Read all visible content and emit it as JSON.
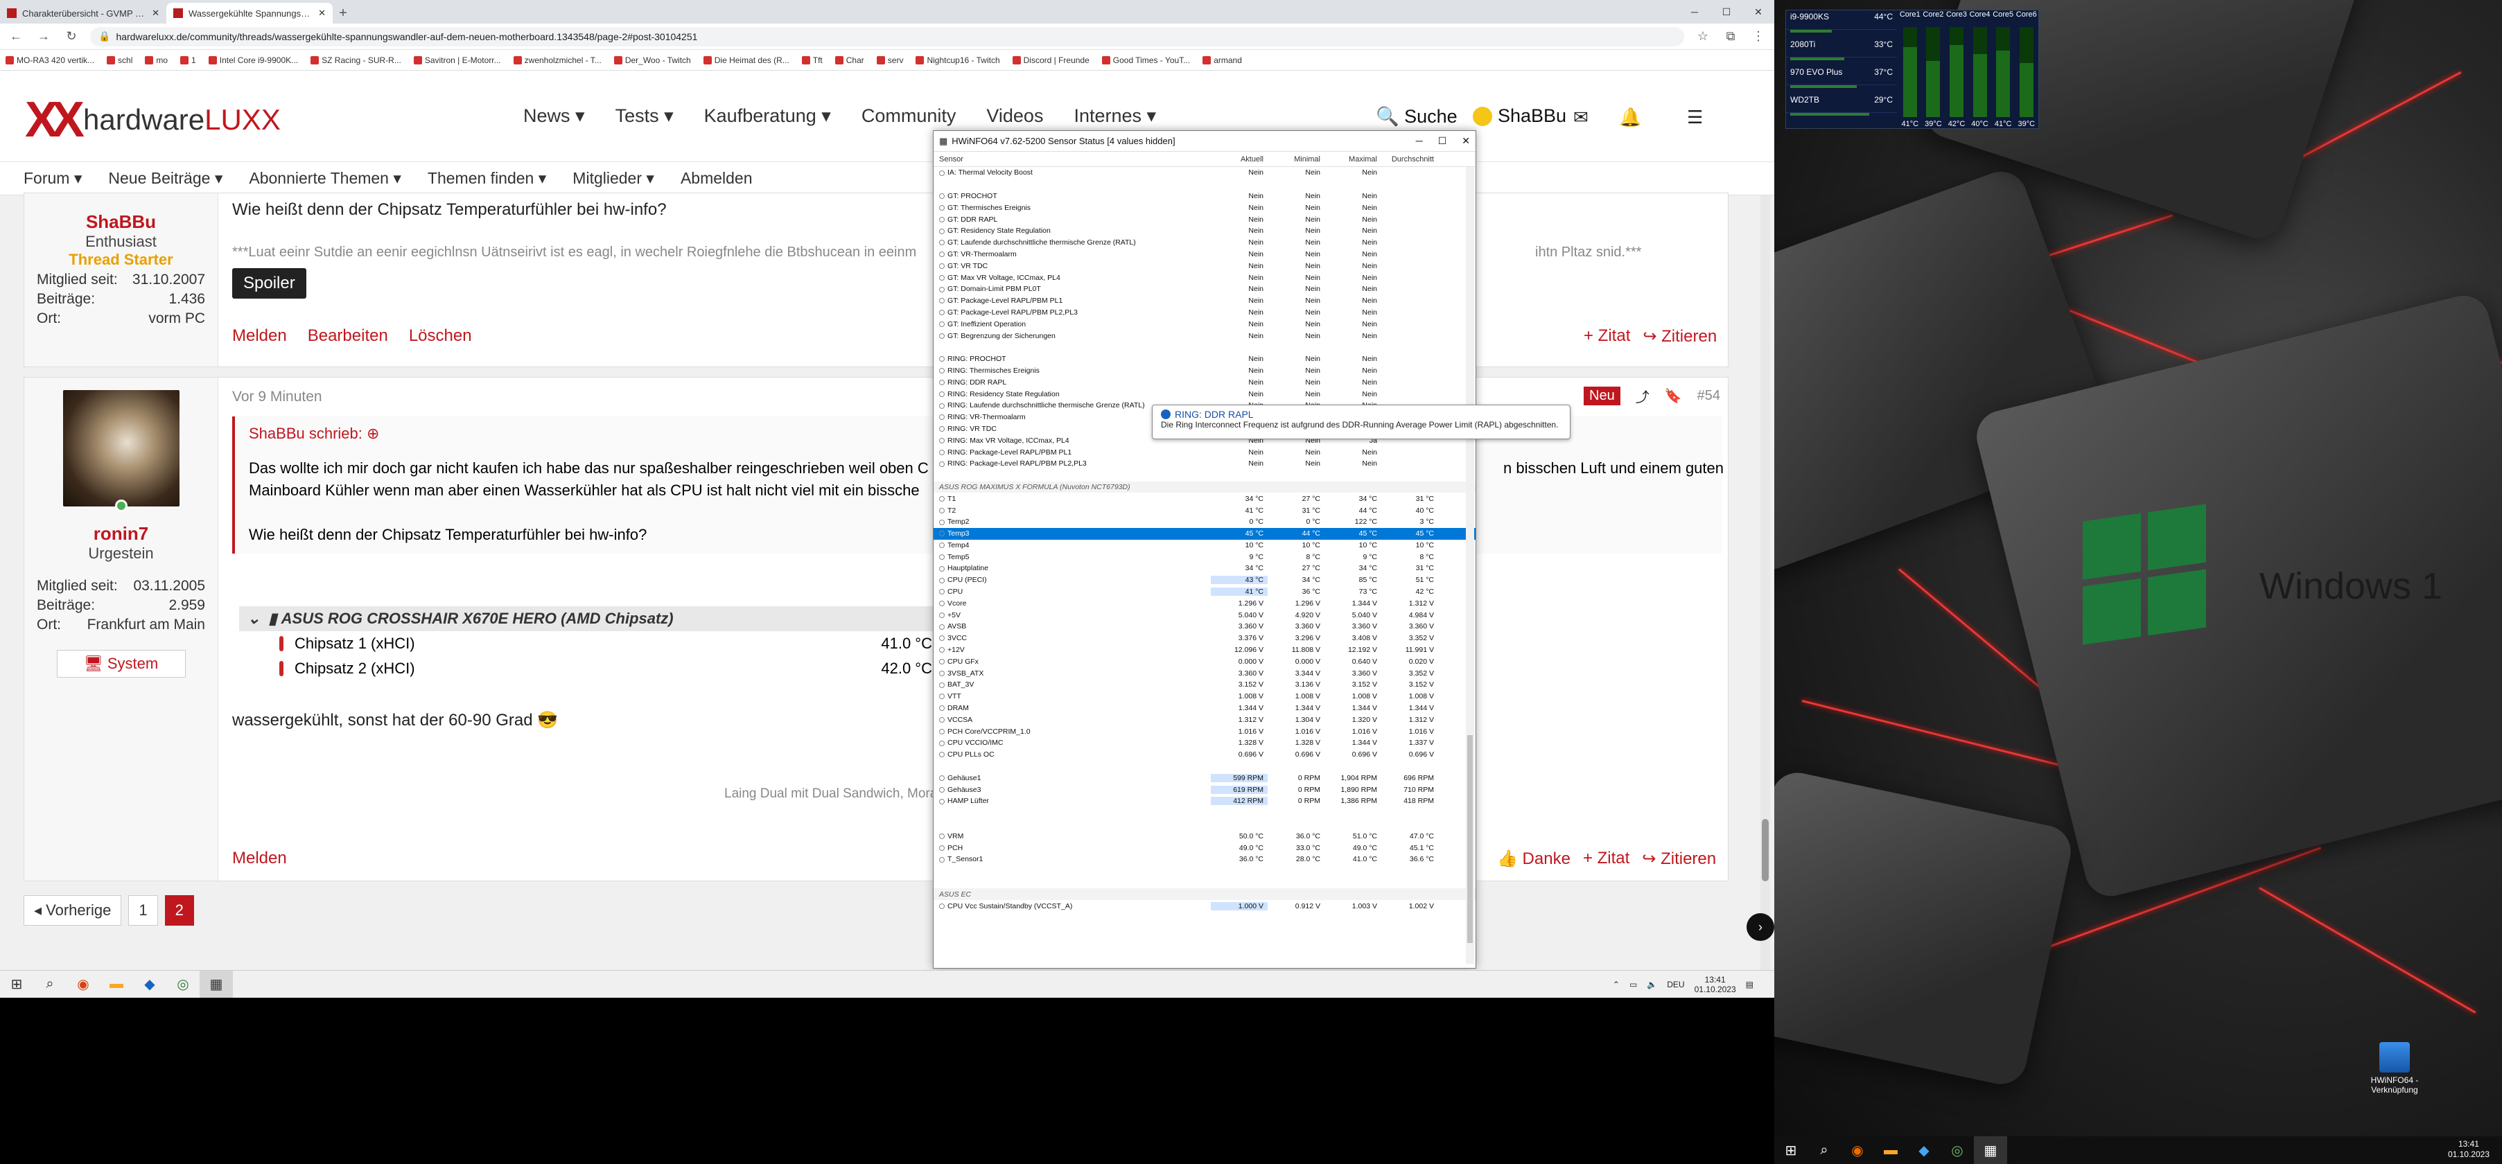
{
  "browser": {
    "tabs": [
      {
        "title": "Charakterübersicht - GVMP - Dr..."
      },
      {
        "title": "Wassergekühlte Spannungswa..."
      }
    ],
    "url": "hardwareluxx.de/community/threads/wassergekühlte-spannungswandler-auf-dem-neuen-motherboard.1343548/page-2#post-30104251",
    "bookmarks": [
      "MO-RA3 420 vertik...",
      "schl",
      "mo",
      "1",
      "Intel Core i9-9900K...",
      "SZ Racing - SUR-R...",
      "Savitron | E-Motorr...",
      "zwenholzmichel - T...",
      "Der_Woo - Twitch",
      "Die Heimat des (R...",
      "Tft",
      "Char",
      "serv",
      "Nightcup16 - Twitch",
      "Discord | Freunde",
      "Good Times - YouT...",
      "armand"
    ]
  },
  "site": {
    "logo_word1": "hardware",
    "logo_word2": "LUXX",
    "nav": [
      "News ▾",
      "Tests ▾",
      "Kaufberatung ▾",
      "Community",
      "Videos",
      "Internes ▾"
    ],
    "search_label": "Suche",
    "user_label": "ShaBBu",
    "subnav": [
      "Forum ▾",
      "Neue Beiträge ▾",
      "Abonnierte Themen ▾",
      "Themen finden ▾",
      "Mitglieder ▾",
      "Abmelden"
    ]
  },
  "post1": {
    "username": "ShaBBu",
    "rank": "Enthusiast",
    "starter": "Thread Starter",
    "stats": [
      {
        "k": "Mitglied seit:",
        "v": "31.10.2007"
      },
      {
        "k": "Beiträge:",
        "v": "1.436"
      },
      {
        "k": "Ort:",
        "v": "vorm PC"
      }
    ],
    "question": "Wie heißt denn der Chipsatz Temperaturfühler bei hw-info?",
    "signature": "***Luat eeinr Sutdie an eenir eegichlnsn Uätnseirivt ist es eagl, in wechelr Roiegfnlehe die Btbshucean in eeinm",
    "signature_tail": "ihtn Pltaz snid.***",
    "spoiler": "Spoiler",
    "actions": [
      "Melden",
      "Bearbeiten",
      "Löschen"
    ],
    "right_actions": [
      "+ Zitat",
      "↪ Zitieren"
    ]
  },
  "post2": {
    "time": "Vor 9 Minuten",
    "new_badge": "Neu",
    "post_no": "#54",
    "username": "ronin7",
    "rank": "Urgestein",
    "stats": [
      {
        "k": "Mitglied seit:",
        "v": "03.11.2005"
      },
      {
        "k": "Beiträge:",
        "v": "2.959"
      },
      {
        "k": "Ort:",
        "v": "Frankfurt am Main"
      }
    ],
    "system_btn": "System",
    "quote_author": "ShaBBu schrieb: ⊕",
    "quote_line1": "Das wollte ich mir doch gar nicht kaufen ich habe das nur spaßeshalber reingeschrieben weil oben C",
    "quote_line1_tail": "n bisschen Luft und einem guten",
    "quote_line2": "Mainboard Kühler wenn man aber einen Wasserkühler hat als CPU ist halt nicht viel mit ein bissche",
    "quote_q": "Wie heißt denn der Chipsatz Temperaturfühler bei hw-info?",
    "table_head": "ASUS ROG CROSSHAIR X670E HERO (AMD Chipsatz)",
    "table_rows": [
      {
        "name": "Chipsatz 1 (xHCI)",
        "val": "41.0 °C",
        "trail": "3"
      },
      {
        "name": "Chipsatz 2 (xHCI)",
        "val": "42.0 °C",
        "trail": "3"
      }
    ],
    "text": "wassergekühlt, sonst hat der 60-90 Grad 😎",
    "signature": "Laing Dual mit Dual Sandwich, Mora3 Dual",
    "melden": "Melden",
    "right_actions": [
      "👍 Danke",
      "+ Zitat",
      "↪ Zitieren"
    ]
  },
  "pager": {
    "prev": "◂ Vorherige",
    "pages": [
      "1",
      "2"
    ],
    "current": "2"
  },
  "hwinfo": {
    "title": "HWiNFO64 v7.62-5200 Sensor Status [4 values hidden]",
    "columns": [
      "Sensor",
      "Aktuell",
      "Minimal",
      "Maximal",
      "Durchschnitt"
    ],
    "rows": [
      [
        "IA: Thermal Velocity Boost",
        "Nein",
        "Nein",
        "Nein",
        ""
      ],
      [
        "",
        "",
        "",
        "",
        ""
      ],
      [
        "GT: PROCHOT",
        "Nein",
        "Nein",
        "Nein",
        ""
      ],
      [
        "GT: Thermisches Ereignis",
        "Nein",
        "Nein",
        "Nein",
        ""
      ],
      [
        "GT: DDR RAPL",
        "Nein",
        "Nein",
        "Nein",
        ""
      ],
      [
        "GT: Residency State Regulation",
        "Nein",
        "Nein",
        "Nein",
        ""
      ],
      [
        "GT: Laufende durchschnittliche thermische Grenze (RATL)",
        "Nein",
        "Nein",
        "Nein",
        ""
      ],
      [
        "GT: VR-Thermoalarm",
        "Nein",
        "Nein",
        "Nein",
        ""
      ],
      [
        "GT: VR TDC",
        "Nein",
        "Nein",
        "Nein",
        ""
      ],
      [
        "GT: Max VR Voltage, ICCmax, PL4",
        "Nein",
        "Nein",
        "Nein",
        ""
      ],
      [
        "GT: Domain-Limit PBM PL0T",
        "Nein",
        "Nein",
        "Nein",
        ""
      ],
      [
        "GT: Package-Level RAPL/PBM PL1",
        "Nein",
        "Nein",
        "Nein",
        ""
      ],
      [
        "GT: Package-Level RAPL/PBM PL2,PL3",
        "Nein",
        "Nein",
        "Nein",
        ""
      ],
      [
        "GT: Ineffizient Operation",
        "Nein",
        "Nein",
        "Nein",
        ""
      ],
      [
        "GT: Begrenzung der Sicherungen",
        "Nein",
        "Nein",
        "Nein",
        ""
      ],
      [
        "",
        "",
        "",
        "",
        ""
      ],
      [
        "RING: PROCHOT",
        "Nein",
        "Nein",
        "Nein",
        ""
      ],
      [
        "RING: Thermisches Ereignis",
        "Nein",
        "Nein",
        "Nein",
        ""
      ],
      [
        "RING: DDR RAPL",
        "Nein",
        "Nein",
        "Nein",
        ""
      ],
      [
        "RING: Residency State Regulation",
        "Nein",
        "Nein",
        "Nein",
        ""
      ],
      [
        "RING: Laufende durchschnittliche thermische Grenze (RATL)",
        "Nein",
        "Nein",
        "Nein",
        ""
      ],
      [
        "RING: VR-Thermoalarm",
        "Nein",
        "Nein",
        "Nein",
        ""
      ],
      [
        "RING: VR TDC",
        "Nein",
        "Nein",
        "Nein",
        ""
      ],
      [
        "RING: Max VR Voltage, ICCmax, PL4",
        "Nein",
        "Nein",
        "Ja",
        ""
      ],
      [
        "RING: Package-Level RAPL/PBM PL1",
        "Nein",
        "Nein",
        "Nein",
        ""
      ],
      [
        "RING: Package-Level RAPL/PBM PL2,PL3",
        "Nein",
        "Nein",
        "Nein",
        ""
      ],
      [
        "",
        "",
        "",
        "",
        ""
      ],
      [
        "ASUS ROG MAXIMUS X FORMULA (Nuvoton NCT6793D)",
        "",
        "",
        "",
        ""
      ],
      [
        "T1",
        "34 °C",
        "27 °C",
        "34 °C",
        "31 °C"
      ],
      [
        "T2",
        "41 °C",
        "31 °C",
        "44 °C",
        "40 °C"
      ],
      [
        "Temp2",
        "0 °C",
        "0 °C",
        "122 °C",
        "3 °C"
      ],
      [
        "Temp3",
        "45 °C",
        "44 °C",
        "45 °C",
        "45 °C"
      ],
      [
        "Temp4",
        "10 °C",
        "10 °C",
        "10 °C",
        "10 °C"
      ],
      [
        "Temp5",
        "9 °C",
        "8 °C",
        "9 °C",
        "8 °C"
      ],
      [
        "Hauptplatine",
        "34 °C",
        "27 °C",
        "34 °C",
        "31 °C"
      ],
      [
        "CPU (PECI)",
        "43 °C",
        "34 °C",
        "85 °C",
        "51 °C"
      ],
      [
        "CPU",
        "41 °C",
        "36 °C",
        "73 °C",
        "42 °C"
      ],
      [
        "Vcore",
        "1.296 V",
        "1.296 V",
        "1.344 V",
        "1.312 V"
      ],
      [
        "+5V",
        "5.040 V",
        "4.920 V",
        "5.040 V",
        "4.984 V"
      ],
      [
        "AVSB",
        "3.360 V",
        "3.360 V",
        "3.360 V",
        "3.360 V"
      ],
      [
        "3VCC",
        "3.376 V",
        "3.296 V",
        "3.408 V",
        "3.352 V"
      ],
      [
        "+12V",
        "12.096 V",
        "11.808 V",
        "12.192 V",
        "11.991 V"
      ],
      [
        "CPU GFx",
        "0.000 V",
        "0.000 V",
        "0.640 V",
        "0.020 V"
      ],
      [
        "3VSB_ATX",
        "3.360 V",
        "3.344 V",
        "3.360 V",
        "3.352 V"
      ],
      [
        "BAT_3V",
        "3.152 V",
        "3.136 V",
        "3.152 V",
        "3.152 V"
      ],
      [
        "VTT",
        "1.008 V",
        "1.008 V",
        "1.008 V",
        "1.008 V"
      ],
      [
        "DRAM",
        "1.344 V",
        "1.344 V",
        "1.344 V",
        "1.344 V"
      ],
      [
        "VCCSA",
        "1.312 V",
        "1.304 V",
        "1.320 V",
        "1.312 V"
      ],
      [
        "PCH Core/VCCPRIM_1.0",
        "1.016 V",
        "1.016 V",
        "1.016 V",
        "1.016 V"
      ],
      [
        "CPU VCCIO/IMC",
        "1.328 V",
        "1.328 V",
        "1.344 V",
        "1.337 V"
      ],
      [
        "CPU PLLs OC",
        "0.696 V",
        "0.696 V",
        "0.696 V",
        "0.696 V"
      ],
      [
        "",
        "",
        "",
        "",
        ""
      ],
      [
        "Gehäuse1",
        "599 RPM",
        "0 RPM",
        "1,904 RPM",
        "696 RPM"
      ],
      [
        "Gehäuse3",
        "619 RPM",
        "0 RPM",
        "1,890 RPM",
        "710 RPM"
      ],
      [
        "HAMP Lüfter",
        "412 RPM",
        "0 RPM",
        "1,386 RPM",
        "418 RPM"
      ],
      [
        "",
        "",
        "",
        "",
        ""
      ],
      [
        "",
        "",
        "",
        "",
        ""
      ],
      [
        "VRM",
        "50.0 °C",
        "36.0 °C",
        "51.0 °C",
        "47.0 °C"
      ],
      [
        "PCH",
        "49.0 °C",
        "33.0 °C",
        "49.0 °C",
        "45.1 °C"
      ],
      [
        "T_Sensor1",
        "36.0 °C",
        "28.0 °C",
        "41.0 °C",
        "36.6 °C"
      ],
      [
        "",
        "",
        "",
        "",
        ""
      ],
      [
        "",
        "",
        "",
        "",
        ""
      ],
      [
        "ASUS EC",
        "",
        "",
        "",
        ""
      ],
      [
        "CPU Vcc Sustain/Standby (VCCST_A)",
        "1.000 V",
        "0.912 V",
        "1.003 V",
        "1.002 V"
      ]
    ],
    "tooltip_title": "RING: DDR RAPL",
    "tooltip_text": "Die Ring Interconnect Frequenz ist aufgrund des DDR-Running Average Power Limit (RAPL) abgeschnitten."
  },
  "taskbar_left": {
    "time": "13:41",
    "date": "01.10.2023",
    "lang": "DEU"
  },
  "gadget": {
    "devices": [
      {
        "name": "i9-9900KS",
        "temp": "44°C"
      },
      {
        "name": "2080Ti",
        "temp": "33°C"
      },
      {
        "name": "970 EVO Plus",
        "temp": "37°C"
      },
      {
        "name": "WD2TB",
        "temp": "29°C"
      }
    ],
    "cores": [
      {
        "label": "Core1",
        "temp": "41°C",
        "level": 0.78
      },
      {
        "label": "Core2",
        "temp": "39°C",
        "level": 0.62
      },
      {
        "label": "Core3",
        "temp": "42°C",
        "level": 0.8
      },
      {
        "label": "Core4",
        "temp": "40°C",
        "level": 0.7
      },
      {
        "label": "Core5",
        "temp": "41°C",
        "level": 0.74
      },
      {
        "label": "Core6",
        "temp": "39°C",
        "level": 0.6
      }
    ]
  },
  "desktop": {
    "wintext": "Windows 1",
    "icon_label": "HWiNFO64 - Verknüpfung"
  },
  "taskbar_right": {
    "time": "13:41",
    "date": "01.10.2023"
  }
}
